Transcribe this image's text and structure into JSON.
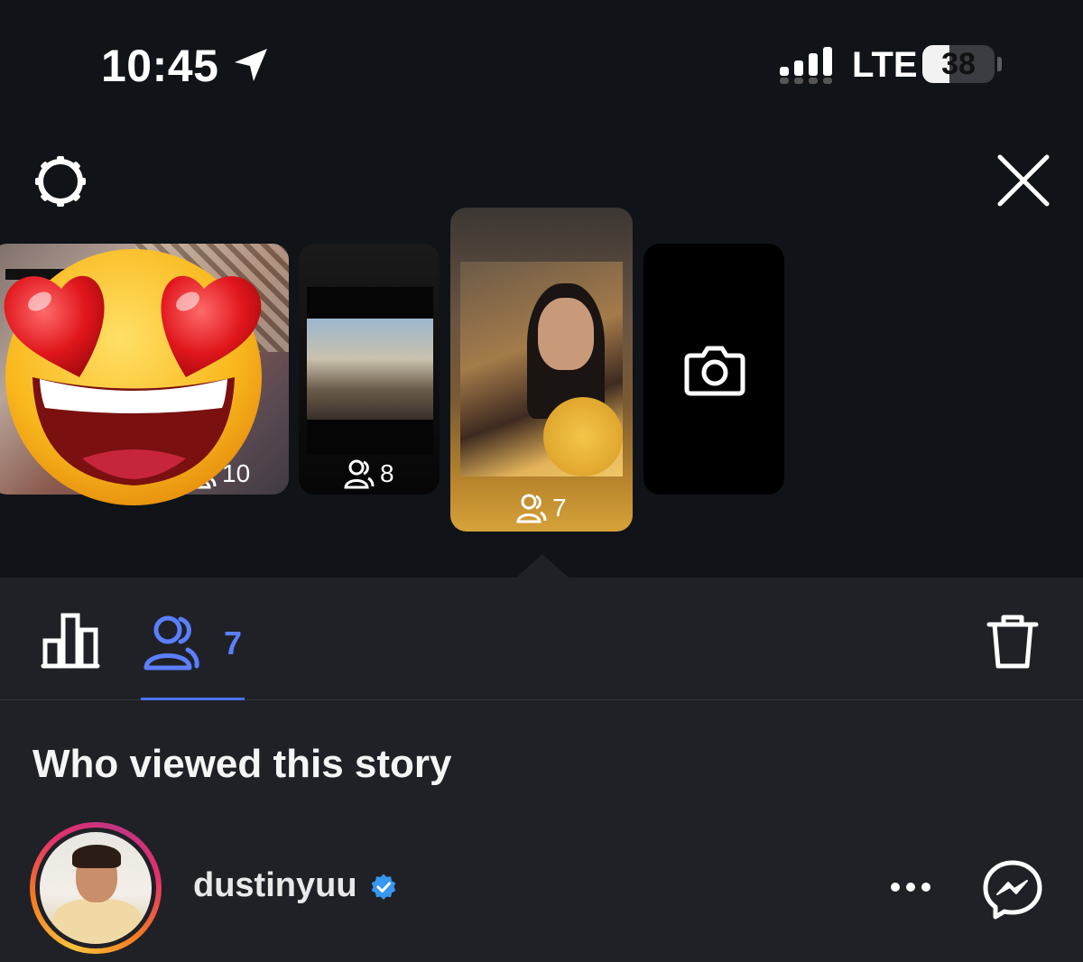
{
  "status_bar": {
    "time": "10:45",
    "network": "LTE",
    "battery_level": "38",
    "battery_fraction": 0.38
  },
  "header": {
    "settings_icon": "gear-icon",
    "close_icon": "close-icon"
  },
  "stories": [
    {
      "view_count": "10"
    },
    {
      "view_count": "8"
    },
    {
      "view_count": "7",
      "selected": true
    },
    {
      "type": "camera",
      "icon": "camera-icon"
    }
  ],
  "overlay": {
    "emoji": "heart-eyes-emoji"
  },
  "tabs": {
    "insights_icon": "bar-chart-icon",
    "viewers_icon": "viewers-icon",
    "viewers_count": "7",
    "delete_icon": "trash-icon",
    "accent_color": "#4c73f5"
  },
  "viewers_section": {
    "title": "Who viewed this story",
    "viewers": [
      {
        "username": "dustinyuu",
        "verified": true
      }
    ]
  }
}
